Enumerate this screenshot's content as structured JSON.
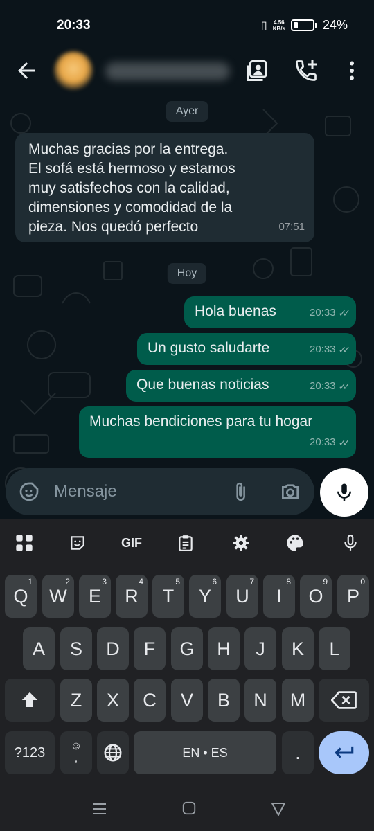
{
  "status": {
    "time": "20:33",
    "net_top": "4.56",
    "net_bottom": "KB/s",
    "battery": "24%"
  },
  "header": {
    "back_icon": "arrow-left-icon",
    "actions": [
      "contact-card-icon",
      "add-call-icon",
      "more-vert-icon"
    ]
  },
  "chat": {
    "date_yesterday": "Ayer",
    "date_today": "Hoy",
    "incoming": [
      {
        "lines": [
          "Muchas gracias por la entrega.",
          "El sofá está hermoso y estamos",
          "muy satisfechos con la calidad,",
          "dimensiones y comodidad de la",
          "pieza. Nos quedó perfecto"
        ],
        "time": "07:51"
      }
    ],
    "outgoing": [
      {
        "text": "Hola buenas",
        "time": "20:33"
      },
      {
        "text": "Un gusto saludarte",
        "time": "20:33"
      },
      {
        "text": "Que buenas noticias",
        "time": "20:33"
      },
      {
        "text": "Muchas bendiciones para tu hogar",
        "time": "20:33"
      }
    ],
    "ticks": "✓✓"
  },
  "composer": {
    "placeholder": "Mensaje"
  },
  "keyboard": {
    "toolbar_gif": "GIF",
    "row1": [
      "Q",
      "W",
      "E",
      "R",
      "T",
      "Y",
      "U",
      "I",
      "O",
      "P"
    ],
    "row1_hints": [
      "1",
      "2",
      "3",
      "4",
      "5",
      "6",
      "7",
      "8",
      "9",
      "0"
    ],
    "row2": [
      "A",
      "S",
      "D",
      "F",
      "G",
      "H",
      "J",
      "K",
      "L"
    ],
    "row3": [
      "Z",
      "X",
      "C",
      "V",
      "B",
      "N",
      "M"
    ],
    "symbols": "?123",
    "emoji_top": "☺",
    "comma": ",",
    "space": "EN • ES",
    "period": "."
  },
  "colors": {
    "background": "#0b141a",
    "incoming_bubble": "#1f2c33",
    "outgoing_bubble": "#005c4b",
    "enter_key": "#a8c7fa"
  }
}
